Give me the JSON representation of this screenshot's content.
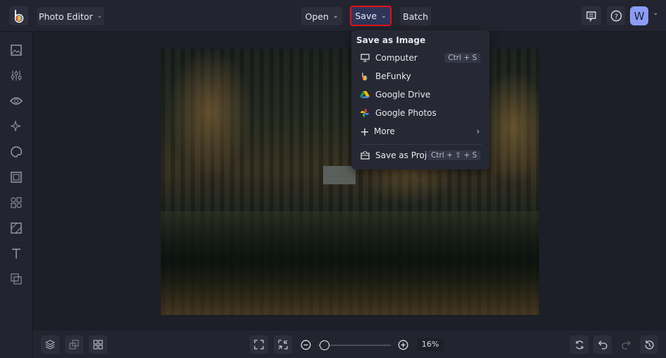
{
  "topbar": {
    "app_menu": "Photo Editor",
    "open": "Open",
    "save": "Save",
    "batch": "Batch",
    "avatar": "W",
    "highlight_color": "#e0121b"
  },
  "save_menu": {
    "heading": "Save as Image",
    "items": [
      {
        "label": "Computer",
        "shortcut": "Ctrl + S",
        "icon": "monitor-icon"
      },
      {
        "label": "BeFunky",
        "icon": "befunky-icon"
      },
      {
        "label": "Google Drive",
        "icon": "google-drive-icon"
      },
      {
        "label": "Google Photos",
        "icon": "google-photos-icon"
      },
      {
        "label": "More",
        "icon": "plus-icon"
      }
    ],
    "project": {
      "label": "Save as Project",
      "shortcut": "Ctrl + ⇧ + S"
    }
  },
  "zoom": {
    "value": "16%",
    "fraction": 0.02
  }
}
